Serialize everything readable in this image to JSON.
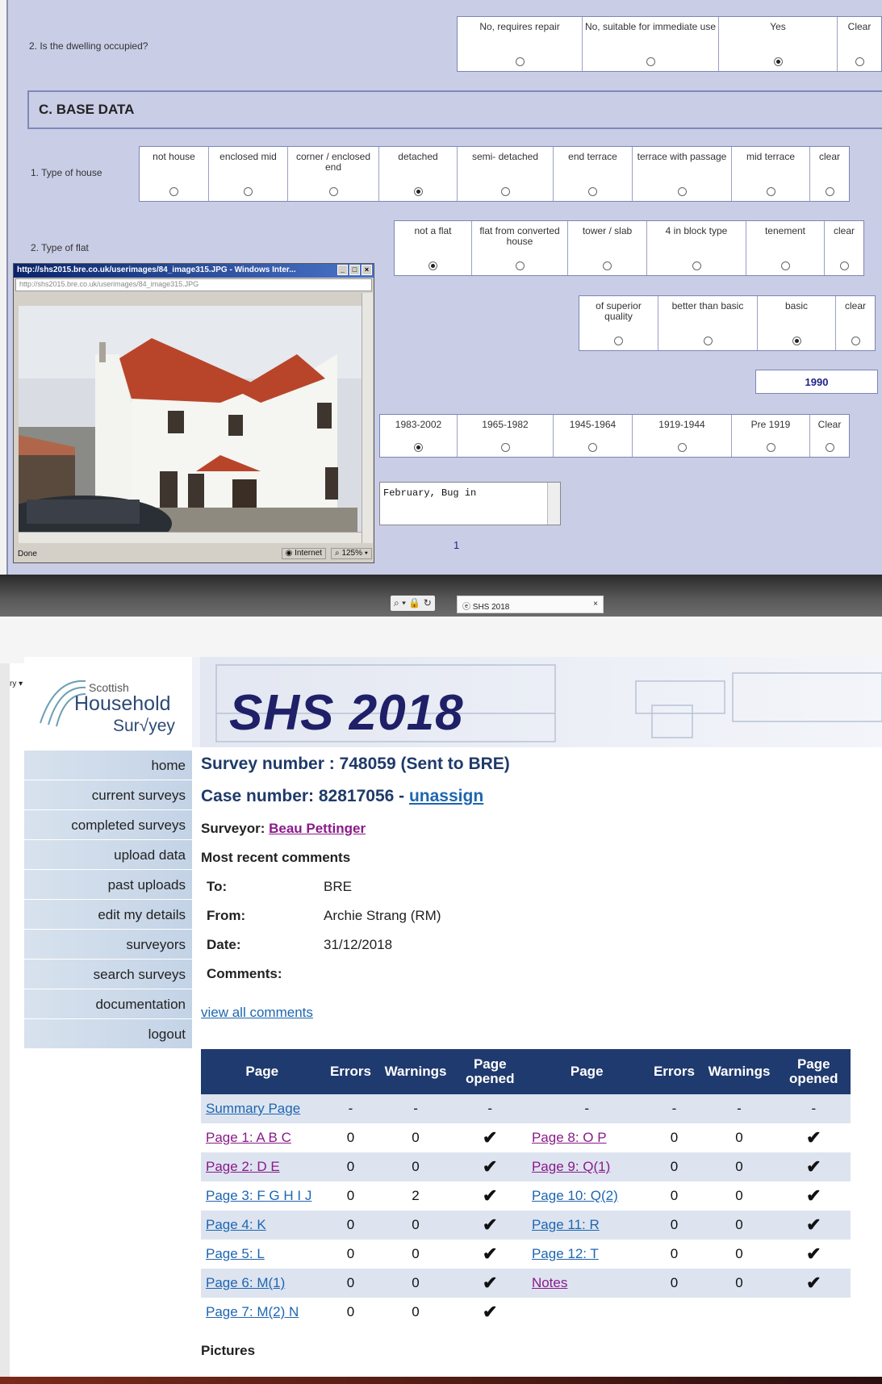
{
  "top_form": {
    "q_occupied": {
      "label": "2. Is the dwelling occupied?",
      "options": [
        {
          "label": "No, requires repair",
          "selected": false
        },
        {
          "label": "No, suitable for immediate use",
          "selected": false
        },
        {
          "label": "Yes",
          "selected": true
        },
        {
          "label": "Clear",
          "selected": false
        }
      ]
    },
    "section_title": "C. BASE DATA",
    "q_house": {
      "label": "1. Type of house",
      "options": [
        {
          "label": "not house",
          "selected": false
        },
        {
          "label": "enclosed mid",
          "selected": false
        },
        {
          "label": "corner / enclosed end",
          "selected": false
        },
        {
          "label": "detached",
          "selected": true
        },
        {
          "label": "semi- detached",
          "selected": false
        },
        {
          "label": "end terrace",
          "selected": false
        },
        {
          "label": "terrace with passage",
          "selected": false
        },
        {
          "label": "mid terrace",
          "selected": false
        },
        {
          "label": "clear",
          "selected": false
        }
      ]
    },
    "q_flat": {
      "label": "2. Type of flat",
      "options": [
        {
          "label": "not a flat",
          "selected": true
        },
        {
          "label": "flat from converted house",
          "selected": false
        },
        {
          "label": "tower / slab",
          "selected": false
        },
        {
          "label": "4 in block type",
          "selected": false
        },
        {
          "label": "tenement",
          "selected": false
        },
        {
          "label": "clear",
          "selected": false
        }
      ]
    },
    "q_quality": {
      "options": [
        {
          "label": "of superior quality",
          "selected": false
        },
        {
          "label": "better than basic",
          "selected": false
        },
        {
          "label": "basic",
          "selected": true
        },
        {
          "label": "clear",
          "selected": false
        }
      ]
    },
    "year_value": "1990",
    "q_period": {
      "options": [
        {
          "label": "1983-2002",
          "selected": true
        },
        {
          "label": "1965-1982",
          "selected": false
        },
        {
          "label": "1945-1964",
          "selected": false
        },
        {
          "label": "1919-1944",
          "selected": false
        },
        {
          "label": "Pre 1919",
          "selected": false
        },
        {
          "label": "Clear",
          "selected": false
        }
      ]
    },
    "comment_text": "February, Bug in",
    "page_number": "1"
  },
  "popup": {
    "title": "http://shs2015.bre.co.uk/userimages/84_image315.JPG - Windows Inter...",
    "address": "http://shs2015.bre.co.uk/userimages/84_image315.JPG",
    "status_done": "Done",
    "status_zone": "Internet",
    "status_zoom": "125%"
  },
  "browser": {
    "tab_title": "SHS 2018",
    "favorites": "llery ▾  Sport"
  },
  "site": {
    "logo_line1": "Scottish",
    "logo_line2": "Household",
    "logo_line3": "Sur√yey",
    "banner_title": "SHS 2018"
  },
  "nav": [
    "home",
    "current surveys",
    "completed surveys",
    "upload data",
    "past uploads",
    "edit my details",
    "surveyors",
    "search surveys",
    "documentation",
    "logout"
  ],
  "survey": {
    "survey_number": "Survey number : 748059 (Sent to BRE)",
    "case_number": "Case number: 82817056 - ",
    "unassign": "unassign",
    "surveyor_label": "Surveyor: ",
    "surveyor_name": "Beau Pettinger",
    "recent_comments": "Most recent comments",
    "to_label": "To:",
    "to_value": "BRE",
    "from_label": "From:",
    "from_value": "Archie Strang (RM)",
    "date_label": "Date:",
    "date_value": "31/12/2018",
    "comments_label": "Comments:",
    "view_all": "view all comments",
    "pictures": "Pictures"
  },
  "page_table": {
    "headers": [
      "Page",
      "Errors",
      "Warnings",
      "Page opened",
      "Page",
      "Errors",
      "Warnings",
      "Page opened"
    ],
    "summary_row": [
      "Summary Page",
      "-",
      "-",
      "-",
      "-",
      "-",
      "-",
      "-"
    ],
    "rows": [
      {
        "left": [
          "Page 1: A B C",
          "0",
          "0",
          "✔"
        ],
        "right": [
          "Page 8: O P",
          "0",
          "0",
          "✔"
        ],
        "visited": true
      },
      {
        "left": [
          "Page 2: D E",
          "0",
          "0",
          "✔"
        ],
        "right": [
          "Page 9: Q(1)",
          "0",
          "0",
          "✔"
        ],
        "visited": true
      },
      {
        "left": [
          "Page 3: F G H I J",
          "0",
          "2",
          "✔"
        ],
        "right": [
          "Page 10: Q(2)",
          "0",
          "0",
          "✔"
        ],
        "visited": false
      },
      {
        "left": [
          "Page 4: K",
          "0",
          "0",
          "✔"
        ],
        "right": [
          "Page 11: R",
          "0",
          "0",
          "✔"
        ],
        "visited": false
      },
      {
        "left": [
          "Page 5: L",
          "0",
          "0",
          "✔"
        ],
        "right": [
          "Page 12: T",
          "0",
          "0",
          "✔"
        ],
        "visited": false
      },
      {
        "left": [
          "Page 6: M(1)",
          "0",
          "0",
          "✔"
        ],
        "right": [
          "Notes",
          "0",
          "0",
          "✔"
        ],
        "visited": false
      },
      {
        "left": [
          "Page 7: M(2) N",
          "0",
          "0",
          "✔"
        ],
        "right": [
          "",
          "",
          "",
          ""
        ],
        "visited": false
      }
    ]
  }
}
